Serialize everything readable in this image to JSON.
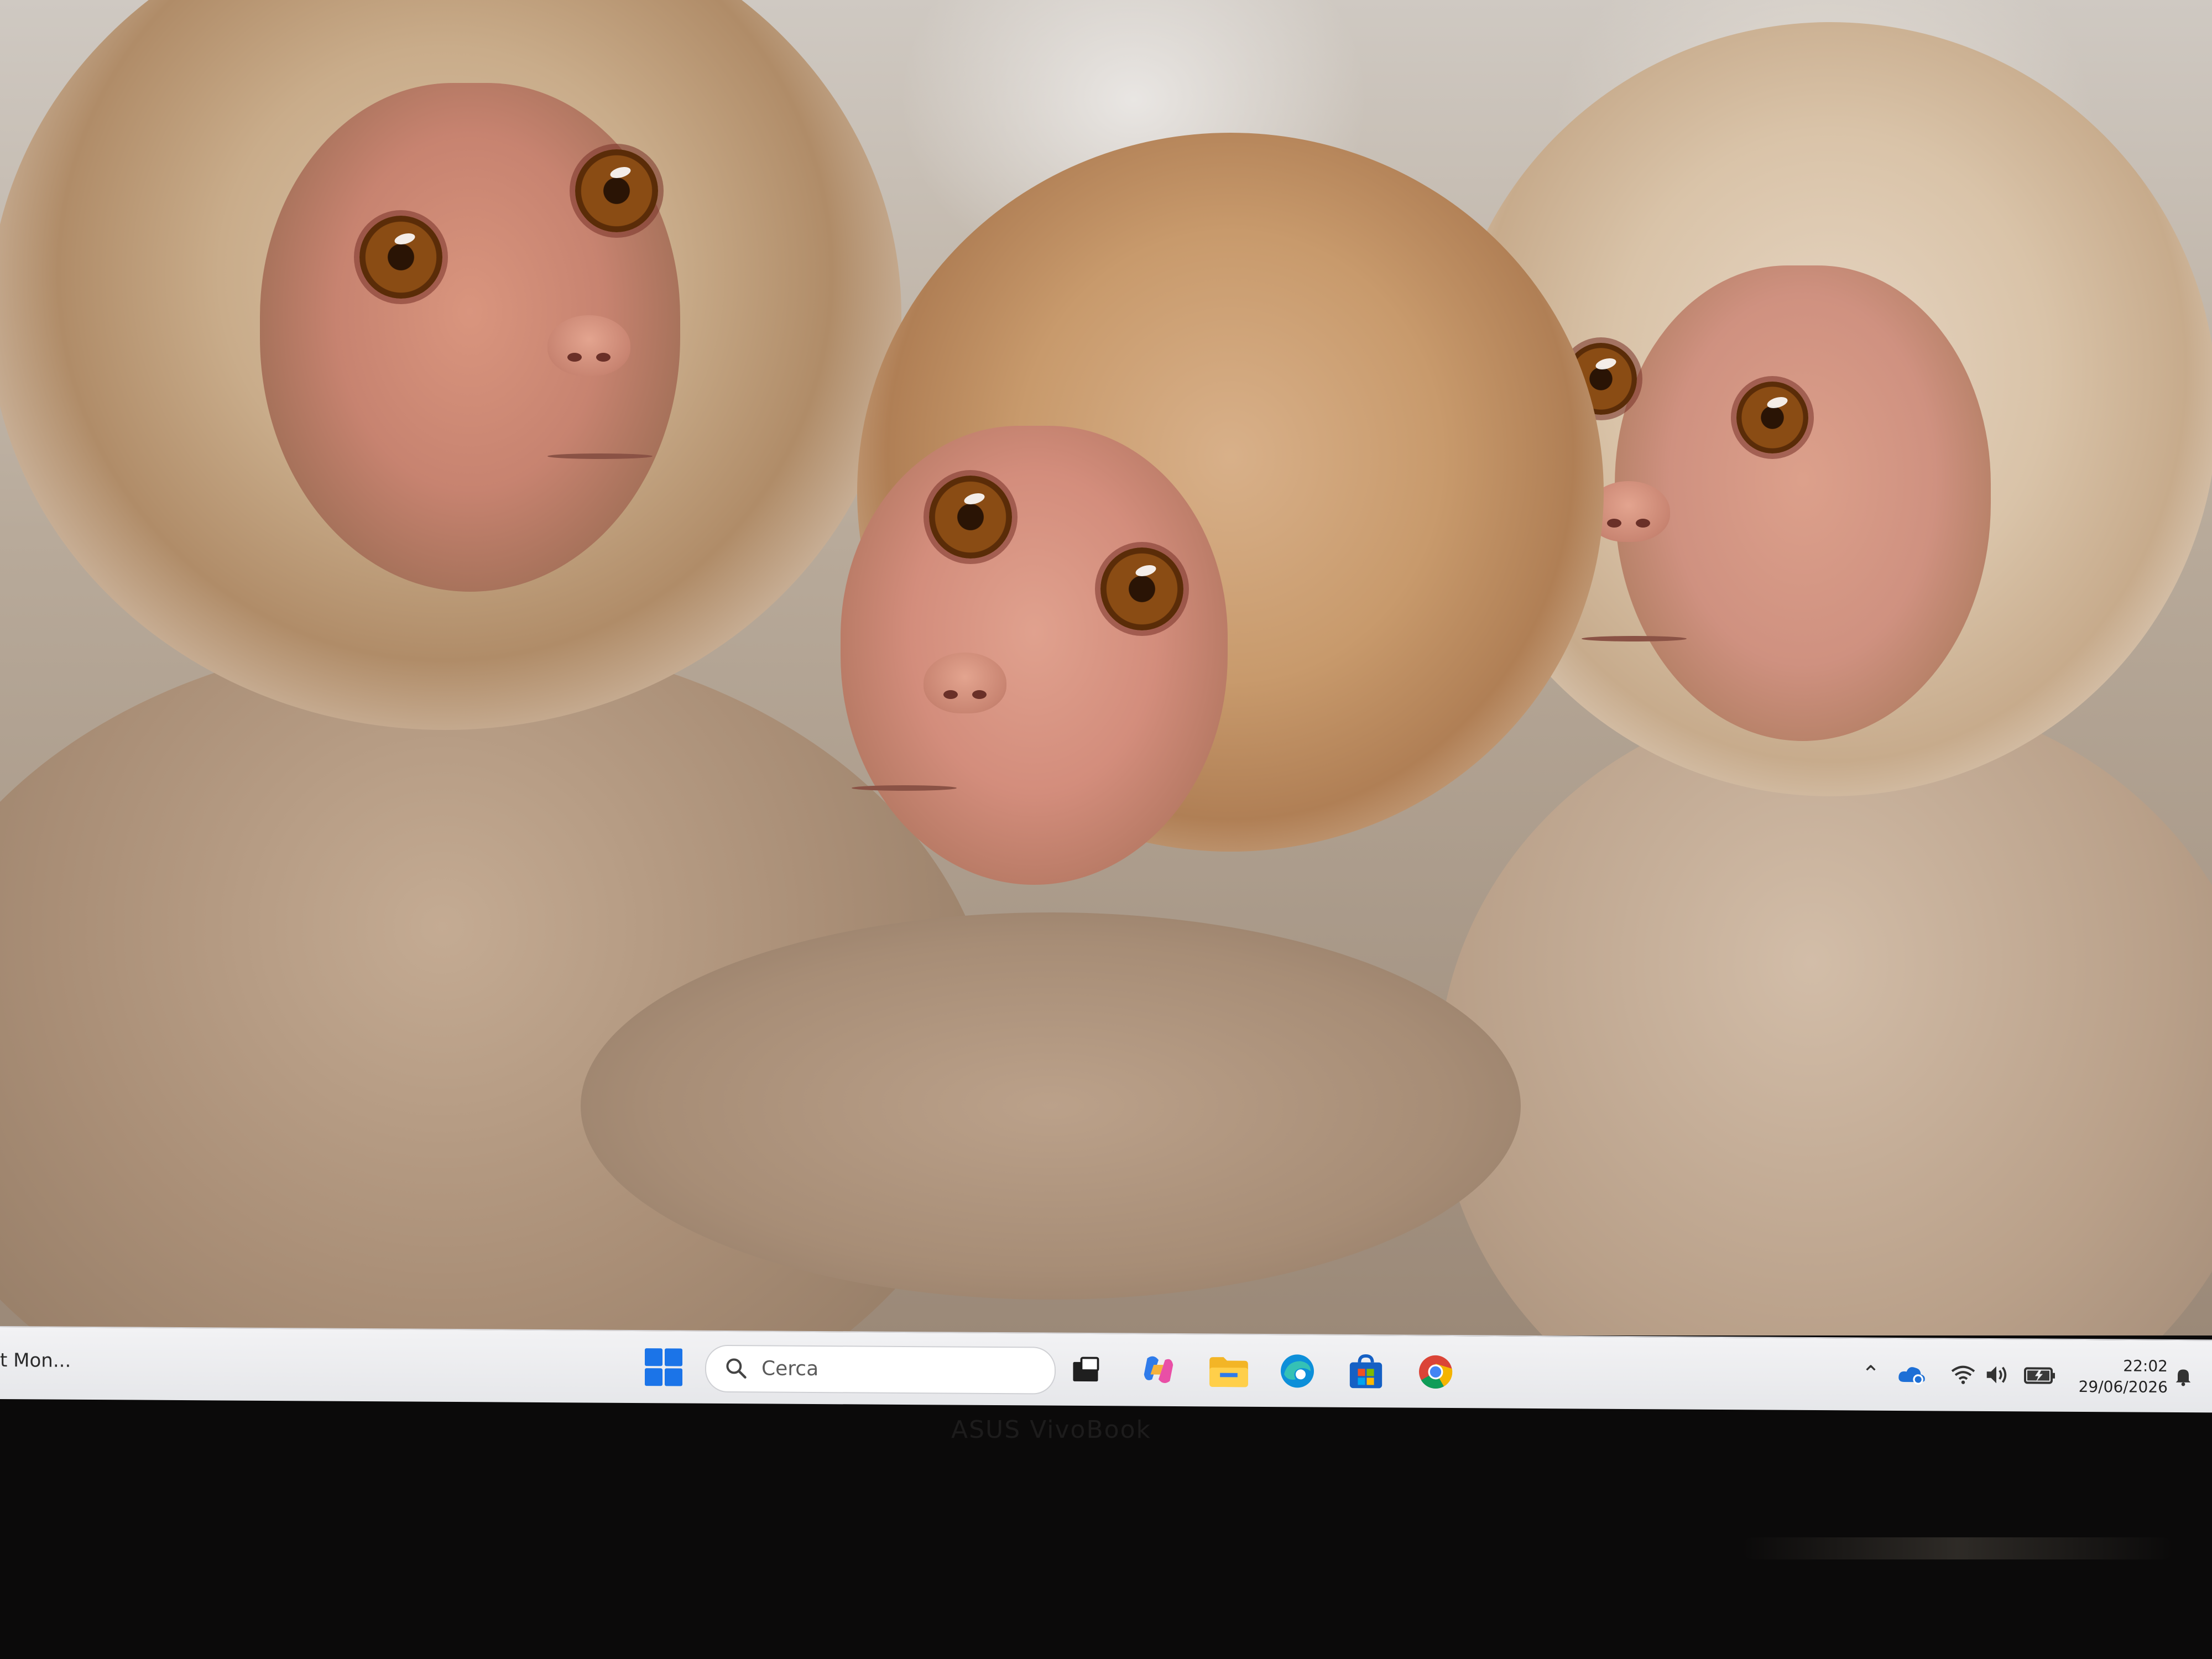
{
  "wallpaper": {
    "subject": "three young snow monkeys huddling together"
  },
  "taskbar": {
    "left_app_label": "t Mon...",
    "search": {
      "placeholder": "Cerca"
    },
    "pinned_apps": [
      {
        "name": "Task View",
        "icon": "taskview-icon"
      },
      {
        "name": "Copilot",
        "icon": "copilot-icon"
      },
      {
        "name": "File Explorer",
        "icon": "folder-icon"
      },
      {
        "name": "Microsoft Edge",
        "icon": "edge-icon"
      },
      {
        "name": "Microsoft Store",
        "icon": "store-icon"
      },
      {
        "name": "Google Chrome",
        "icon": "chrome-icon"
      }
    ],
    "tray": {
      "time": "22:02",
      "date": "29/06/2026"
    }
  },
  "bezel": {
    "brand": "ASUS VivoBook"
  },
  "colors": {
    "taskbar_bg": "#eeeff1",
    "windows_blue": "#1b74e8",
    "bezel": "#0b0a0a"
  }
}
